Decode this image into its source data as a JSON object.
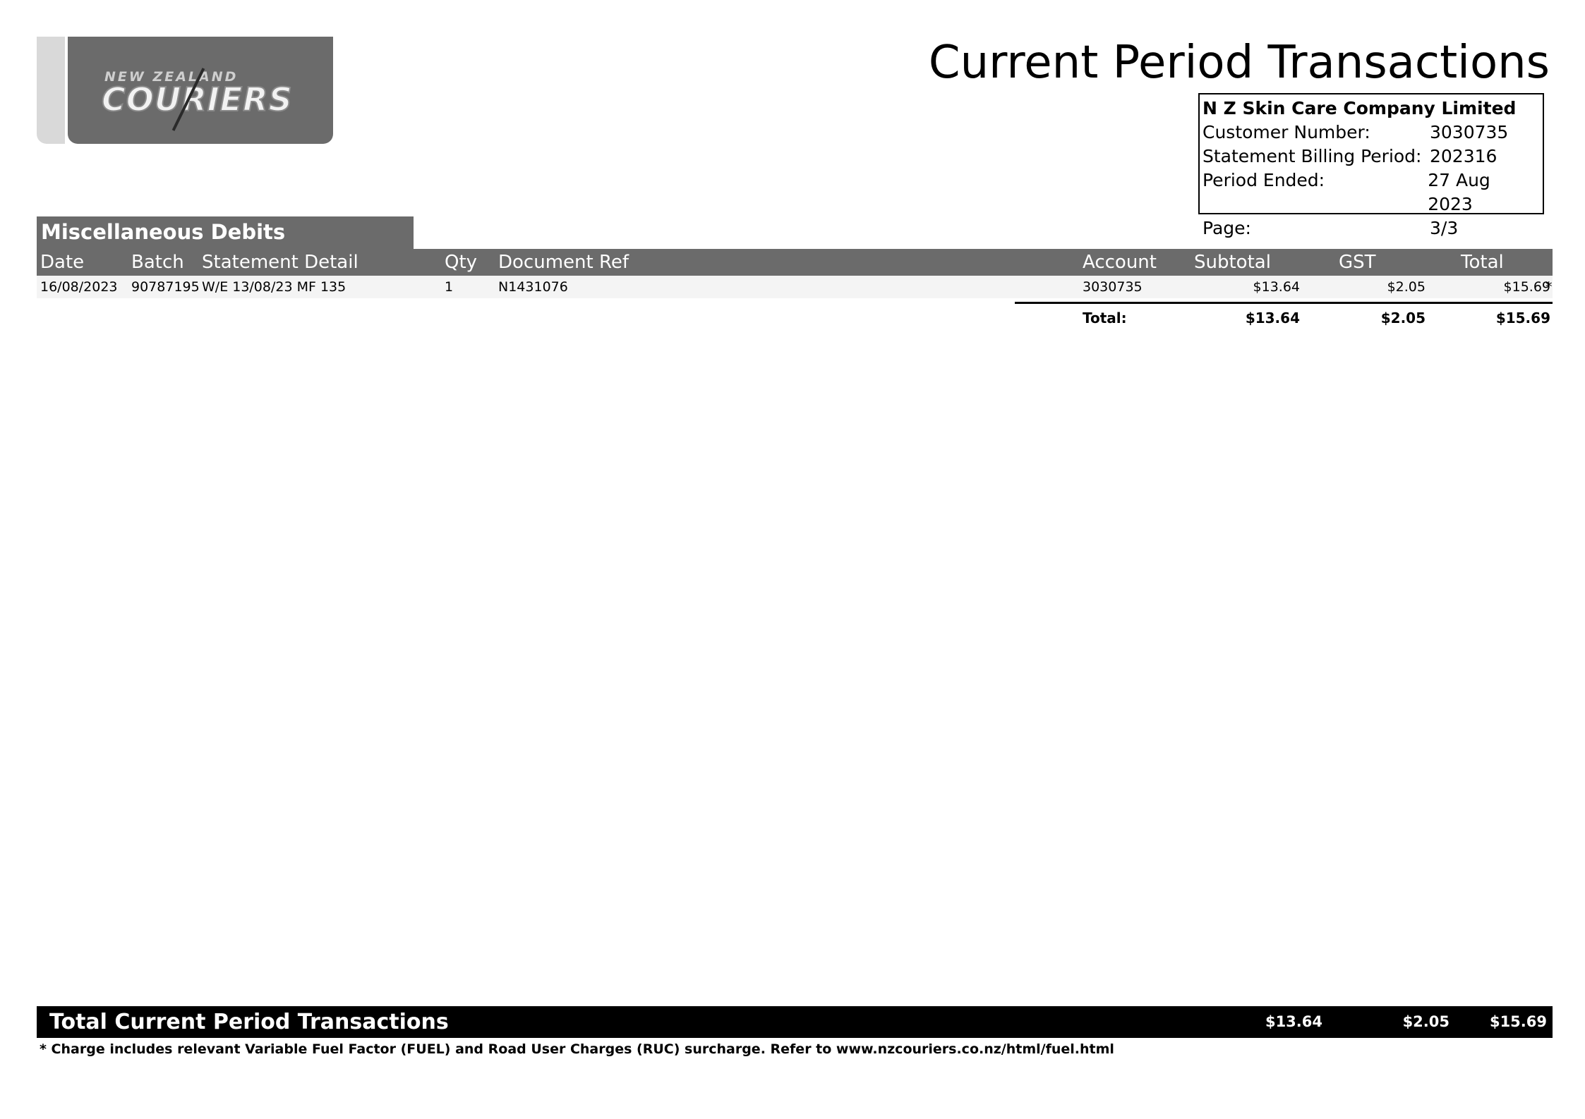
{
  "logo": {
    "top_text": "NEW ZEALAND",
    "main_text": "COURIERS"
  },
  "title": "Current Period Transactions",
  "customer": {
    "name": "N Z Skin Care Company Limited",
    "rows": [
      {
        "label": "Customer Number:",
        "value": "3030735"
      },
      {
        "label": "Statement Billing Period:",
        "value": "202316"
      },
      {
        "label": "Period Ended:",
        "value": "27 Aug 2023"
      },
      {
        "label": "Page:",
        "value": "3/3"
      }
    ]
  },
  "section": {
    "title": "Miscellaneous Debits",
    "columns": {
      "date": "Date",
      "batch": "Batch",
      "detail": "Statement Detail",
      "qty": "Qty",
      "docref": "Document Ref",
      "account": "Account",
      "subtotal": "Subtotal",
      "gst": "GST",
      "total": "Total"
    },
    "rows": [
      {
        "date": "16/08/2023",
        "batch": "90787195",
        "detail": "W/E 13/08/23 MF 135",
        "qty": "1",
        "docref": "N1431076",
        "account": "3030735",
        "subtotal": "$13.64",
        "gst": "$2.05",
        "total": "$15.69",
        "mark": "*"
      }
    ],
    "total": {
      "label": "Total:",
      "subtotal": "$13.64",
      "gst": "$2.05",
      "total": "$15.69"
    }
  },
  "grand_total": {
    "label": "Total Current Period Transactions",
    "subtotal": "$13.64",
    "gst": "$2.05",
    "total": "$15.69"
  },
  "footnote": "* Charge includes relevant Variable Fuel Factor (FUEL) and Road User Charges (RUC) surcharge. Refer to www.nzcouriers.co.nz/html/fuel.html"
}
